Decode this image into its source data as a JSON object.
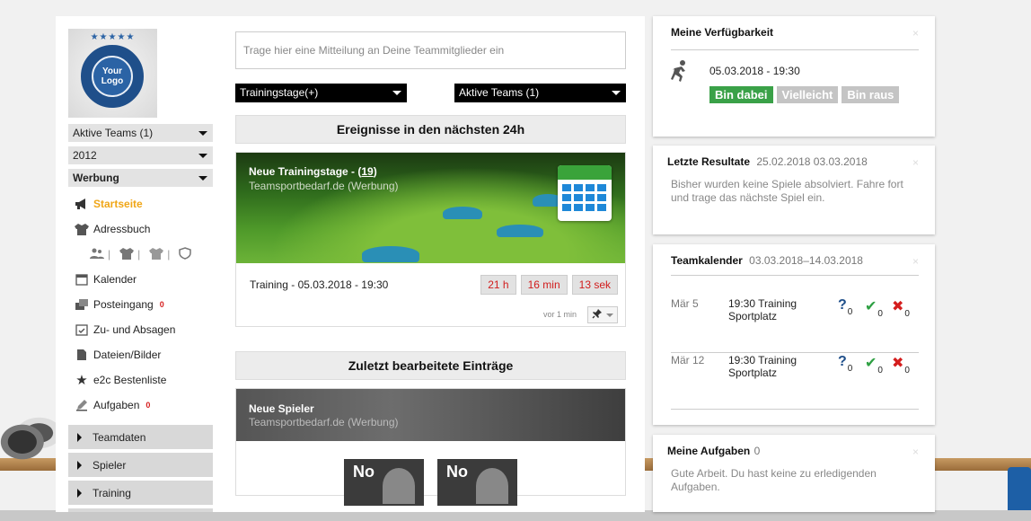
{
  "logo": {
    "text": "Your Logo",
    "stars": "★★★★★"
  },
  "left": {
    "selects": [
      {
        "label": "Aktive Teams (1)"
      },
      {
        "label": "2012"
      },
      {
        "label": "Werbung"
      }
    ],
    "nav": [
      {
        "label": "Startseite",
        "icon": "megaphone-icon",
        "active": true
      },
      {
        "label": "Adressbuch",
        "icon": "shirt-icon"
      },
      {
        "label": "Kalender",
        "icon": "calendar-icon"
      },
      {
        "label": "Posteingang",
        "icon": "inbox-icon",
        "badge": "0"
      },
      {
        "label": "Zu- und Absagen",
        "icon": "checkbox-calendar-icon"
      },
      {
        "label": "Dateien/Bilder",
        "icon": "file-icon"
      },
      {
        "label": "e2c Bestenliste",
        "icon": "star-icon"
      },
      {
        "label": "Aufgaben",
        "icon": "pencil-icon",
        "badge": "0"
      }
    ],
    "sub_icons_sep": "|",
    "accordion": [
      "Teamdaten",
      "Spieler",
      "Training"
    ]
  },
  "center": {
    "message_placeholder": "Trage hier eine Mitteilung an Deine Teammitglieder ein",
    "filter_left": "Trainingstage(+)",
    "filter_right": "Aktive Teams (1)",
    "section1": "Ereignisse in den nächsten 24h",
    "card1": {
      "title_prefix": "Neue Trainingstage - (",
      "title_count": "19",
      "title_suffix": ")",
      "subtitle": "Teamsportbedarf.de (Werbung)",
      "event_label": "Training - 05.03.2018 - 19:30",
      "countdown": [
        "21 h",
        "16 min",
        "13 sek"
      ],
      "ago": "vor 1 min",
      "pin_icon": "pushpin-icon"
    },
    "section2": "Zuletzt bearbeitete Einträge",
    "card2": {
      "title": "Neue Spieler",
      "subtitle": "Teamsportbedarf.de (Werbung)",
      "players": [
        "No",
        "No"
      ]
    }
  },
  "right": {
    "availability": {
      "title": "Meine Verfügbarkeit",
      "datetime": "05.03.2018 - 19:30",
      "buttons": [
        "Bin dabei",
        "Vielleicht",
        "Bin raus"
      ]
    },
    "results": {
      "title": "Letzte Resultate",
      "range": "25.02.2018 03.03.2018",
      "text": "Bisher wurden keine Spiele absolviert. Fahre fort und trage das nächste Spiel ein."
    },
    "calendar": {
      "title": "Teamkalender",
      "range": "03.03.2018–14.03.2018",
      "events": [
        {
          "date": "Mär 5",
          "time_type": "19:30 Training",
          "place": "Sportplatz",
          "q": "0",
          "yes": "0",
          "no": "0"
        },
        {
          "date": "Mär 12",
          "time_type": "19:30 Training",
          "place": "Sportplatz",
          "q": "0",
          "yes": "0",
          "no": "0"
        }
      ]
    },
    "tasks": {
      "title": "Meine Aufgaben",
      "count": "0",
      "text": "Gute Arbeit. Du hast keine zu erledigenden Aufgaben."
    },
    "close_glyph": "×"
  }
}
